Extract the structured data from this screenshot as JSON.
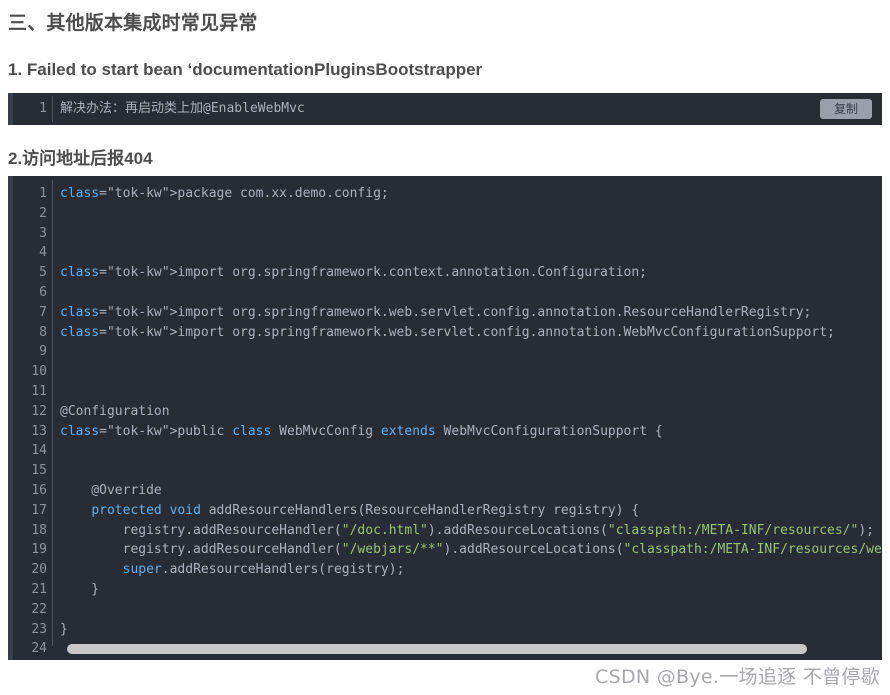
{
  "headings": {
    "main": "三、其他版本集成时常见异常",
    "sub1": "1. Failed to start bean  ‘documentationPluginsBootstrapper",
    "sub2": "2.访问地址后报404"
  },
  "code_block_small": {
    "copy_label": "复制",
    "lines": [
      {
        "no": "1",
        "text": "解决办法：再启动类上加@EnableWebMvc"
      }
    ]
  },
  "code_block_big": {
    "lines": [
      {
        "no": "1",
        "text": "package com.xx.demo.config;"
      },
      {
        "no": "2",
        "text": ""
      },
      {
        "no": "3",
        "text": ""
      },
      {
        "no": "4",
        "text": ""
      },
      {
        "no": "5",
        "text": "import org.springframework.context.annotation.Configuration;"
      },
      {
        "no": "6",
        "text": ""
      },
      {
        "no": "7",
        "text": "import org.springframework.web.servlet.config.annotation.ResourceHandlerRegistry;"
      },
      {
        "no": "8",
        "text": "import org.springframework.web.servlet.config.annotation.WebMvcConfigurationSupport;"
      },
      {
        "no": "9",
        "text": ""
      },
      {
        "no": "10",
        "text": ""
      },
      {
        "no": "11",
        "text": ""
      },
      {
        "no": "12",
        "text": "@Configuration"
      },
      {
        "no": "13",
        "text": "public class WebMvcConfig extends WebMvcConfigurationSupport {"
      },
      {
        "no": "14",
        "text": ""
      },
      {
        "no": "15",
        "text": ""
      },
      {
        "no": "16",
        "text": "    @Override"
      },
      {
        "no": "17",
        "text": "    protected void addResourceHandlers(ResourceHandlerRegistry registry) {"
      },
      {
        "no": "18",
        "text": "        registry.addResourceHandler(\"/doc.html\").addResourceLocations(\"classpath:/META-INF/resources/\");"
      },
      {
        "no": "19",
        "text": "        registry.addResourceHandler(\"/webjars/**\").addResourceLocations(\"classpath:/META-INF/resources/webjars/\");"
      },
      {
        "no": "20",
        "text": "        super.addResourceHandlers(registry);"
      },
      {
        "no": "21",
        "text": "    }"
      },
      {
        "no": "22",
        "text": ""
      },
      {
        "no": "23",
        "text": "}"
      },
      {
        "no": "24",
        "text": ""
      }
    ]
  },
  "watermark": "CSDN @Bye.一场追逐 不曾停歇",
  "colors": {
    "code_bg": "#282c34",
    "code_accent": "#383e4a",
    "gutter_text": "#8e949e",
    "code_text": "#abb2bf",
    "keyword": "#61afef",
    "string": "#98c379",
    "heading": "#4d4d4d",
    "copy_btn_bg": "#9b9fab",
    "scrollbar_thumb": "#c8c8c8",
    "watermark": "#a8a8ad"
  }
}
